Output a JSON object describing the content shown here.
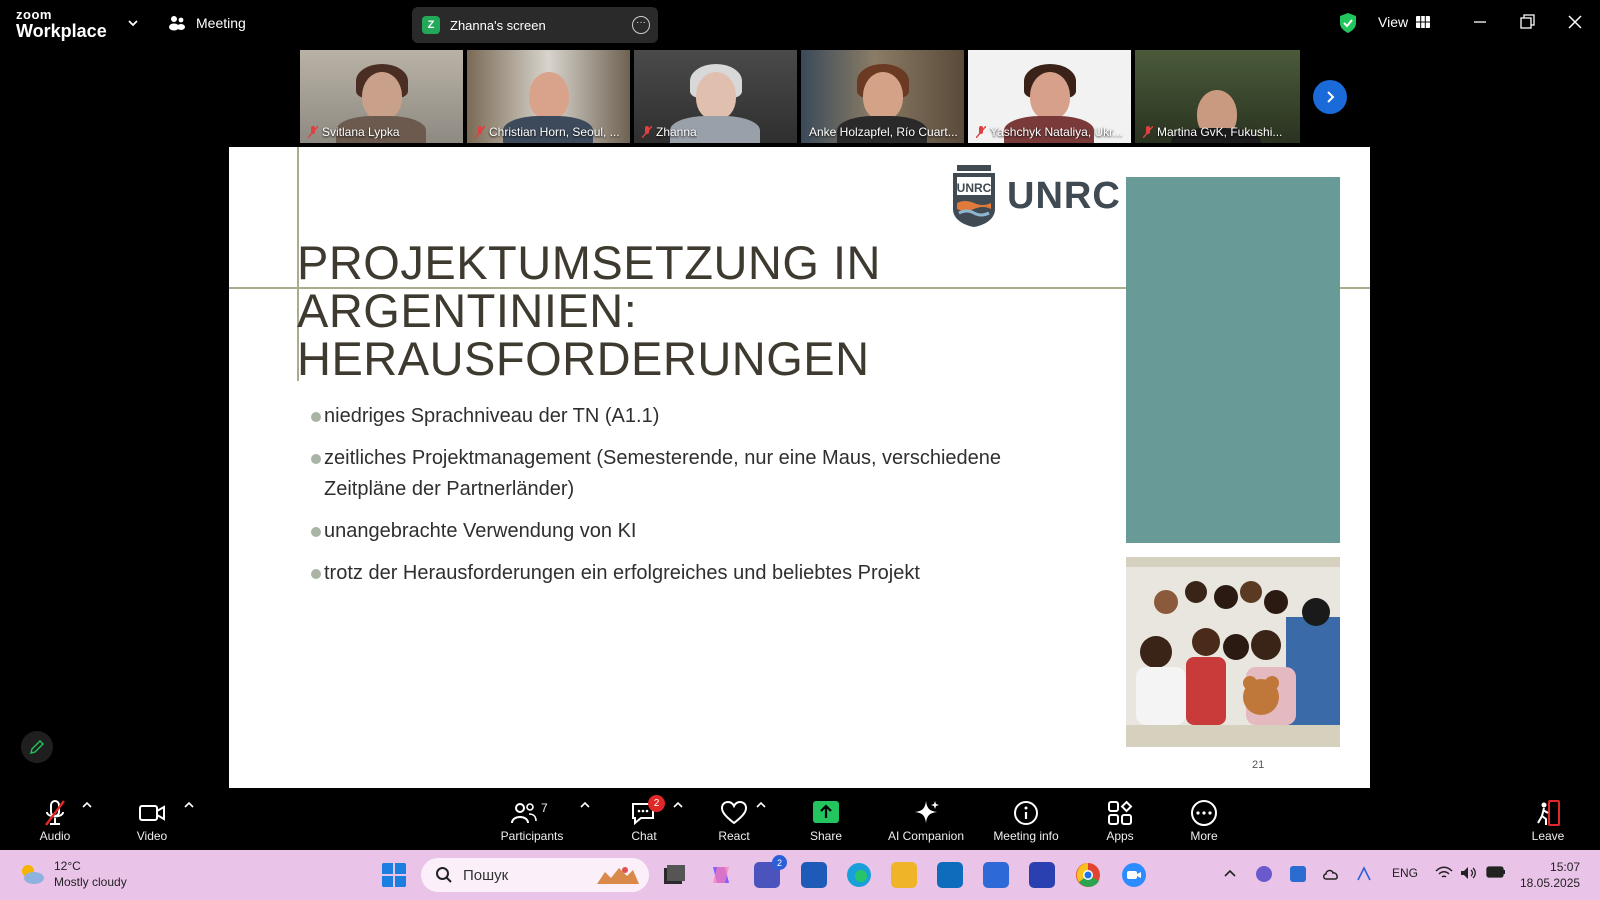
{
  "app": {
    "brand_top": "zoom",
    "brand_bottom": "Workplace",
    "meeting_label": "Meeting"
  },
  "share": {
    "badge": "Z",
    "title": "Zhanna's screen"
  },
  "topright": {
    "view_label": "View"
  },
  "participants_strip": [
    {
      "name": "Svitlana Lypka",
      "active": false
    },
    {
      "name": "Christian Horn, Seoul, ...",
      "active": false
    },
    {
      "name": "Zhanna",
      "active": false
    },
    {
      "name": "Anke Holzapfel, Río Cuart...",
      "active": true
    },
    {
      "name": "Yashchyk Nataliya, Ukr...",
      "active": false
    },
    {
      "name": "Martina GvK, Fukushi...",
      "active": false
    }
  ],
  "slide": {
    "logo_text": "UNRC",
    "title_line1": "PROJEKTUMSETZUNG IN ARGENTINIEN:",
    "title_line2": "HERAUSFORDERUNGEN",
    "bullets": [
      "niedriges Sprachniveau der TN (A1.1)",
      "zeitliches Projektmanagement (Semesterende, nur eine Maus, verschiedene Zeitpläne der Partnerländer)",
      "unangebrachte Verwendung von KI",
      "trotz der Herausforderungen ein erfolgreiches und beliebtes Projekt"
    ],
    "page_number": "21",
    "accent_color": "#689b97"
  },
  "toolbar": {
    "audio": "Audio",
    "video": "Video",
    "participants": "Participants",
    "participants_count": "7",
    "chat": "Chat",
    "chat_badge": "2",
    "react": "React",
    "share": "Share",
    "ai": "AI Companion",
    "info": "Meeting info",
    "apps": "Apps",
    "more": "More",
    "leave": "Leave"
  },
  "taskbar": {
    "temp": "12°C",
    "weather": "Mostly cloudy",
    "search_placeholder": "Пошук",
    "teams_badge": "2",
    "lang": "ENG",
    "time": "15:07",
    "date": "18.05.2025"
  }
}
